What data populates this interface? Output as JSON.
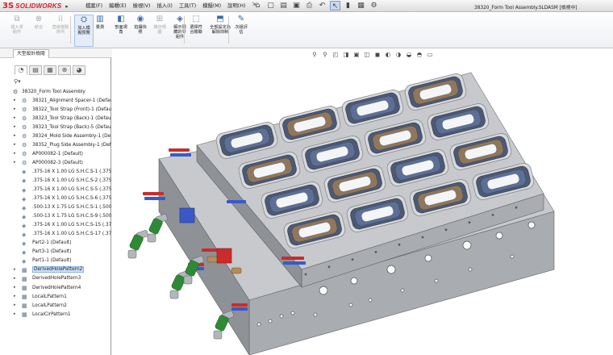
{
  "app": {
    "logo_glyph": "3S",
    "logo_text": "SOLIDWORKS",
    "menu_arrow": "▸"
  },
  "menu": {
    "items": [
      {
        "label": "檔案(F)"
      },
      {
        "label": "編輯(E)"
      },
      {
        "label": "檢視(V)"
      },
      {
        "label": "插入(I)"
      },
      {
        "label": "工具(T)"
      },
      {
        "label": "模擬(M)"
      },
      {
        "label": "說明(H)"
      }
    ],
    "pin_glyph": "⇲"
  },
  "quick_toolbar": {
    "icons": [
      {
        "name": "home-icon",
        "glyph": "⌂"
      },
      {
        "name": "new-document-icon",
        "glyph": "▢"
      },
      {
        "name": "open-folder-icon",
        "glyph": "▤"
      },
      {
        "name": "save-icon",
        "glyph": "▣"
      },
      {
        "name": "print-icon",
        "glyph": "⎙"
      },
      {
        "name": "undo-icon",
        "glyph": "↶"
      },
      {
        "name": "select-cursor-icon",
        "glyph": "↖"
      },
      {
        "name": "traffic-light-icon",
        "glyph": "▮"
      },
      {
        "name": "rebuild-icon",
        "glyph": "▦"
      },
      {
        "name": "options-gear-icon",
        "glyph": "⚙"
      }
    ]
  },
  "document_title": "38320_Form Tool Assembly.SLDASM [檢視中]",
  "command_manager": {
    "items": [
      {
        "name": "insert-component-button",
        "icon": "insert-component-icon",
        "glyph": "⧉",
        "label": "插入零\n組件",
        "enabled": false,
        "active": false
      },
      {
        "name": "mate-button",
        "icon": "mate-icon",
        "glyph": "⊗",
        "label": "結合",
        "enabled": false,
        "active": false
      },
      {
        "name": "linear-pattern-button",
        "icon": "linear-pattern-icon",
        "glyph": "⁞⁞",
        "label": "直線複製\n排列",
        "enabled": false,
        "active": false
      },
      {
        "name": "smart-fasteners-button",
        "icon": "smart-fasteners-icon",
        "glyph": "⛭",
        "label": "加入模\n擬預覽",
        "enabled": true,
        "active": true
      },
      {
        "name": "measure-button",
        "icon": "measure-icon",
        "glyph": "▥",
        "label": "量測",
        "enabled": true,
        "active": false
      },
      {
        "name": "section-view-button",
        "icon": "section-view-icon",
        "glyph": "◧",
        "label": "剖面視\n角",
        "enabled": true,
        "active": false
      },
      {
        "name": "snapshot-button",
        "icon": "camera-icon",
        "glyph": "◉",
        "label": "拍攝快\n照",
        "enabled": true,
        "active": false
      },
      {
        "name": "exploded-view-button",
        "icon": "exploded-view-icon",
        "glyph": "⊞",
        "label": "爆炸視\n圖",
        "enabled": false,
        "active": false
      },
      {
        "name": "show-hidden-button",
        "icon": "show-hidden-icon",
        "glyph": "◈",
        "label": "顯示隱\n藏的零\n組件",
        "enabled": true,
        "active": false
      },
      {
        "name": "select-all-button",
        "icon": "select-icon",
        "glyph": "⬚",
        "label": "選擇符\n合關聯",
        "enabled": true,
        "active": false
      },
      {
        "name": "suppress-all-button",
        "icon": "suppress-icon",
        "glyph": "⬒",
        "label": "全部設定為\n解除抑制",
        "enabled": true,
        "active": false
      },
      {
        "name": "evaluate-button",
        "icon": "evaluate-icon",
        "glyph": "✎",
        "label": "次組評\n估",
        "enabled": true,
        "active": false
      }
    ]
  },
  "tabs": {
    "active_label": "大型設計檢閱"
  },
  "feature_tree": {
    "panel_tabs": [
      {
        "name": "feature-manager-tab",
        "glyph": "◔"
      },
      {
        "name": "property-manager-tab",
        "glyph": "▤"
      },
      {
        "name": "configuration-manager-tab",
        "glyph": "▦"
      },
      {
        "name": "dimxpert-tab",
        "glyph": "⊕"
      },
      {
        "name": "display-manager-tab",
        "glyph": "◕"
      }
    ],
    "filter_glyph": "⚲▾",
    "root": {
      "label": "38320_Form Tool Assembly"
    },
    "items": [
      {
        "label": "38321_Alignment Spacer-1 (Defau",
        "type": "subassembly",
        "expander": "▸",
        "highlighted": false
      },
      {
        "label": "38322_Tool Strap (Front)-1 (Defau",
        "type": "subassembly",
        "expander": "▸",
        "highlighted": false
      },
      {
        "label": "38323_Tool Strap (Back)-1 (Defau",
        "type": "subassembly",
        "expander": "▸",
        "highlighted": false
      },
      {
        "label": "38323_Tool Strap (Back)-5 (Defau",
        "type": "subassembly",
        "expander": "▸",
        "highlighted": false
      },
      {
        "label": "38324_Mold Side Assembly-1 (De",
        "type": "subassembly",
        "expander": "▸",
        "highlighted": false
      },
      {
        "label": "38352_Plug Side Assembly-1 (Def",
        "type": "subassembly",
        "expander": "▸",
        "highlighted": false
      },
      {
        "label": "AP000082-1 (Default)",
        "type": "subassembly",
        "expander": "▸",
        "highlighted": false
      },
      {
        "label": "AP000082-3 (Default)",
        "type": "subassembly",
        "expander": "▸",
        "highlighted": false
      },
      {
        "label": ".375-16 X 1.00 LG S.H.C.S-1 (.375-",
        "type": "part",
        "expander": "",
        "highlighted": false
      },
      {
        "label": ".375-16 X 1.00 LG S.H.C.S-2 (.375-",
        "type": "part",
        "expander": "",
        "highlighted": false
      },
      {
        "label": ".375-16 X 1.00 LG S.H.C.S-5 (.375-",
        "type": "part",
        "expander": "",
        "highlighted": false
      },
      {
        "label": ".375-16 X 1.00 LG S.H.C.S-6 (.375-",
        "type": "part",
        "expander": "",
        "highlighted": false
      },
      {
        "label": ".500-13 X 1.75 LG S.H.C.S-1 (.500-",
        "type": "part",
        "expander": "",
        "highlighted": false
      },
      {
        "label": ".500-13 X 1.75 LG S.H.C.S-9 (.500-",
        "type": "part",
        "expander": "",
        "highlighted": false
      },
      {
        "label": ".375-16 X 1.00 LG S.H.C.S-15 (.375",
        "type": "part",
        "expander": "",
        "highlighted": false
      },
      {
        "label": ".375-16 X 1.00 LG S.H.C.S-17 (.375",
        "type": "part",
        "expander": "",
        "highlighted": false
      },
      {
        "label": "Part2-1 (Default)",
        "type": "part",
        "expander": "",
        "highlighted": false
      },
      {
        "label": "Part3-1 (Default)",
        "type": "part",
        "expander": "",
        "highlighted": false
      },
      {
        "label": "Part1-1 (Default)",
        "type": "part",
        "expander": "",
        "highlighted": false
      },
      {
        "label": "DerivedHolePattern2",
        "type": "pattern",
        "expander": "▸",
        "highlighted": true
      },
      {
        "label": "DerivedHolePattern3",
        "type": "pattern",
        "expander": "▸",
        "highlighted": false
      },
      {
        "label": "DerivedHolePattern4",
        "type": "pattern",
        "expander": "▸",
        "highlighted": false
      },
      {
        "label": "LocalLPattern1",
        "type": "pattern",
        "expander": "▸",
        "highlighted": false
      },
      {
        "label": "LocalLPattern2",
        "type": "pattern",
        "expander": "▸",
        "highlighted": false
      },
      {
        "label": "LocalCirPattern1",
        "type": "pattern",
        "expander": "▸",
        "highlighted": false
      }
    ]
  },
  "view_toolbar": {
    "icons": [
      {
        "name": "zoom-to-fit-icon",
        "glyph": "⚲"
      },
      {
        "name": "zoom-area-icon",
        "glyph": "⚲"
      },
      {
        "name": "previous-view-icon",
        "glyph": "◰"
      },
      {
        "name": "section-view-icon",
        "glyph": "◨"
      },
      {
        "name": "dynamic-annotation-icon",
        "glyph": "▣"
      },
      {
        "name": "view-orientation-icon",
        "glyph": "◫"
      },
      {
        "name": "display-style-icon",
        "glyph": "◼"
      },
      {
        "name": "hide-show-items-icon",
        "glyph": "◐"
      },
      {
        "name": "edit-appearance-icon",
        "glyph": "◑"
      },
      {
        "name": "apply-scene-icon",
        "glyph": "◒"
      },
      {
        "name": "view-settings-icon",
        "glyph": "◓"
      },
      {
        "name": "display-pane-icon",
        "glyph": "▭"
      }
    ]
  },
  "colors": {
    "plate_top": "#c7c9cc",
    "plate_front": "#a9acb0",
    "plate_side": "#8e9195",
    "cavity_frame": "#d7d9dc",
    "cavity_rim": "#4d5a74",
    "cavity_inner": "#f4f5f6",
    "cavity_ring": "#90765b",
    "fitting_green": "#2f8a35",
    "fitting_blue": "#3a59c8",
    "fitting_red": "#cc2b2b",
    "fitting_silver": "#b3b6ba",
    "brass": "#b98b57"
  }
}
